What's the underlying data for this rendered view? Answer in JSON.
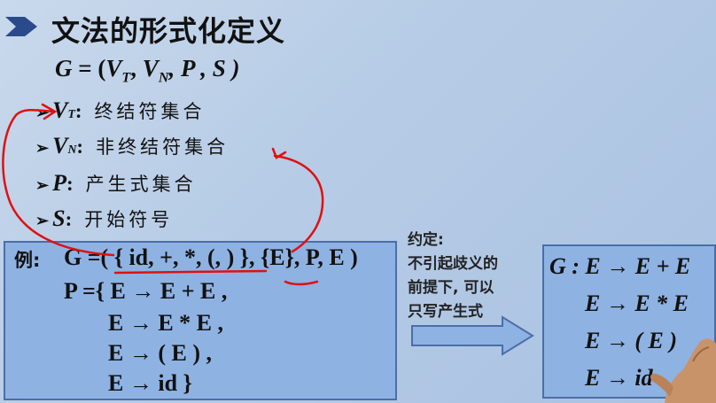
{
  "title": "文法的形式化定义",
  "formula": {
    "text_g": "G",
    "text_eq": " = (",
    "vt": "V",
    "vt_sub": "T",
    "vn": "V",
    "vn_sub": "N",
    "rest": ", P , S )"
  },
  "definitions": [
    {
      "bullet": "➢",
      "symbol": "V",
      "sub": "T",
      "sep": ":",
      "desc": "终结符集合"
    },
    {
      "bullet": "➢",
      "symbol": "V",
      "sub": "N",
      "sep": ":",
      "desc": "非终结符集合"
    },
    {
      "bullet": "➢",
      "symbol": "P",
      "sub": "",
      "sep": " :",
      "desc": "产生式集合"
    },
    {
      "bullet": "➢",
      "symbol": "S",
      "sub": "",
      "sep": " :",
      "desc": "开始符号"
    }
  ],
  "example": {
    "label": "例:",
    "lines": [
      "G =( { id, +, *, (, ) }, {E}, P, E )",
      "P ={ E → E + E ,",
      "E → E * E ,",
      "E → ( E ) ,",
      "E → id }"
    ]
  },
  "note": {
    "lines": [
      "约定:",
      "不引起歧义的",
      "前提下, 可以",
      "只写产生式"
    ]
  },
  "grammar_box": {
    "lines": [
      "G : E → E + E",
      "E → E * E",
      "E → ( E )",
      "E → id"
    ]
  },
  "colors": {
    "background": "#b7cce6",
    "box_fill": "#8eb2e2",
    "box_border": "#4b6ea8",
    "annotation_red": "#e01010",
    "title_bullet": "#2a4a8c"
  }
}
